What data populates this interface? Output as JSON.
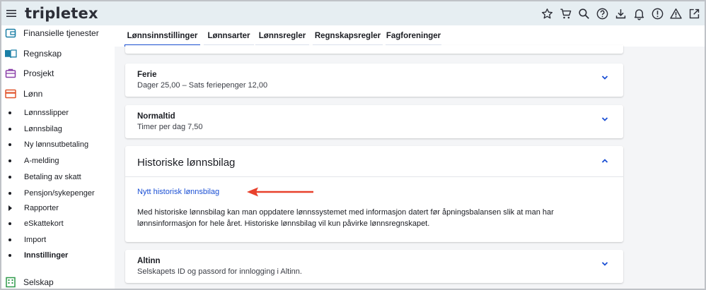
{
  "app": {
    "logo": "tripletex"
  },
  "topbar": {
    "icons": [
      "star-icon",
      "cart-icon",
      "search-icon",
      "help-icon",
      "download-icon",
      "bell-icon",
      "alert-circle-icon",
      "warning-icon",
      "external-link-icon"
    ]
  },
  "sidebar": {
    "items": [
      {
        "label": "Finansielle tjenester",
        "icon": "wallet-icon"
      },
      {
        "label": "Regnskap",
        "icon": "book-icon"
      },
      {
        "label": "Prosjekt",
        "icon": "briefcase-icon"
      },
      {
        "label": "Lønn",
        "icon": "payroll-icon"
      }
    ],
    "sub_items": [
      {
        "label": "Lønnsslipper"
      },
      {
        "label": "Lønnsbilag"
      },
      {
        "label": "Ny lønnsutbetaling"
      },
      {
        "label": "A-melding"
      },
      {
        "label": "Betaling av skatt"
      },
      {
        "label": "Pensjon/sykepenger"
      },
      {
        "label": "Rapporter"
      },
      {
        "label": "eSkattekort"
      },
      {
        "label": "Import"
      },
      {
        "label": "Innstillinger"
      }
    ],
    "bottom_item": {
      "label": "Selskap",
      "icon": "building-icon"
    }
  },
  "tabs": [
    {
      "label": "Lønnsinnstillinger",
      "active": true
    },
    {
      "label": "Lønnsarter"
    },
    {
      "label": "Lønnsregler"
    },
    {
      "label": "Regnskapsregler"
    },
    {
      "label": "Fagforeninger"
    }
  ],
  "cards": {
    "ferie": {
      "title": "Ferie",
      "subtitle": "Dager 25,00  –  Sats feriepenger 12,00"
    },
    "normaltid": {
      "title": "Normaltid",
      "subtitle": "Timer per dag 7,50"
    },
    "historiske": {
      "title": "Historiske lønnsbilag",
      "link": "Nytt historisk lønnsbilag",
      "description": "Med historiske lønnsbilag kan man oppdatere lønnssystemet med informasjon datert før åpningsbalansen slik at man har lønnsinformasjon for hele året. Historiske lønnsbilag vil kun påvirke lønnsregnskapet."
    },
    "altinn": {
      "title": "Altinn",
      "subtitle": "Selskapets ID og passord for innlogging i Altinn."
    }
  },
  "colors": {
    "accent": "#1a4fd4",
    "annotation_arrow": "#e8412c",
    "topbar": "#e6eef2"
  }
}
